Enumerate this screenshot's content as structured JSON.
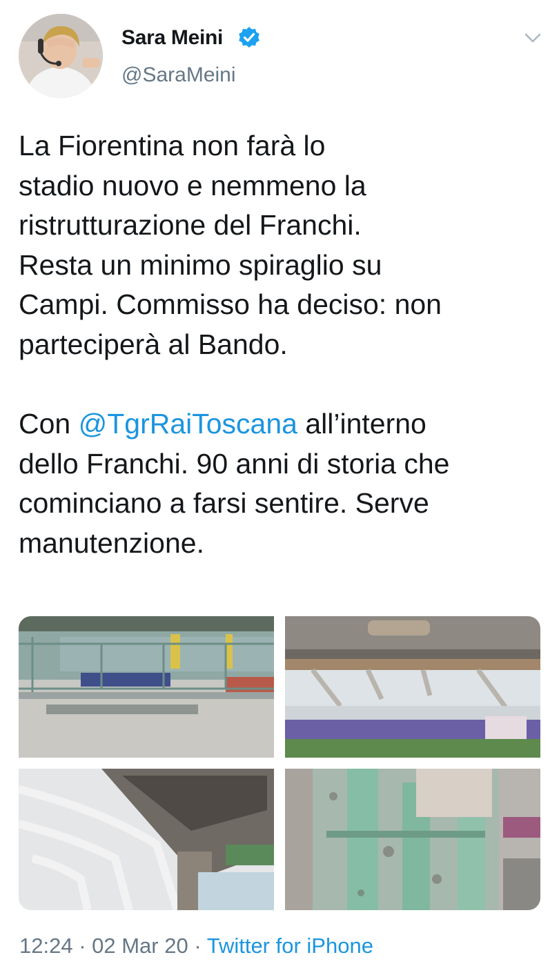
{
  "author": {
    "name": "Sara Meini",
    "handle": "@SaraMeini",
    "verified": true
  },
  "tweet": {
    "paragraph1": "La Fiorentina non farà lo\nstadio nuovo e nemmeno la\nristrutturazione del Franchi.\nResta un minimo spiraglio su\nCampi. Commisso ha deciso: non\nparteciperà al Bando.",
    "p2_prefix": "Con ",
    "p2_mention": "@TgrRaiToscana",
    "p2_suffix": " all’interno\ndello Franchi. 90 anni di storia che\ncominciano a farsi sentire. Serve\nmanutenzione."
  },
  "meta": {
    "time": "12:24",
    "separator1": " · ",
    "date": "02 Mar 20",
    "separator2": " · ",
    "source": "Twitter for iPhone"
  },
  "colors": {
    "text": "#14171a",
    "secondary": "#657786",
    "link": "#1b95e0",
    "verified": "#1da1f2"
  }
}
